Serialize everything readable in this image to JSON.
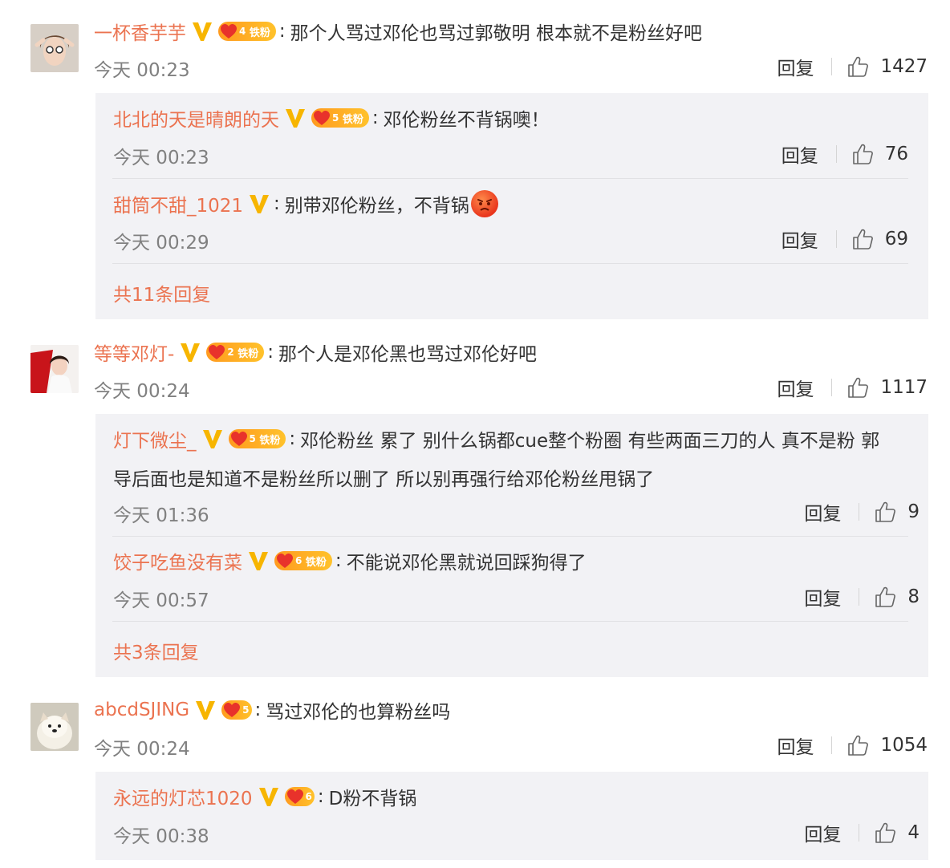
{
  "labels": {
    "reply": "回复"
  },
  "colors": {
    "username": "#eb7350",
    "reply_bg": "#f2f2f5",
    "time": "#808080",
    "badge_gold": "#ffb21f"
  },
  "comments": [
    {
      "user": "一杯香芋芋",
      "badge": "铁粉",
      "level": "4",
      "text": "那个人骂过邓伦也骂过郭敬明 根本就不是粉丝好吧",
      "time": "今天 00:23",
      "likes": "1427",
      "replies": [
        {
          "user": "北北的天是晴朗的天",
          "badge": "铁粉",
          "level": "5",
          "text": "邓伦粉丝不背锅噢！",
          "time": "今天 00:23",
          "likes": "76"
        },
        {
          "user": "甜筒不甜_1021",
          "text": "别带邓伦粉丝，不背锅",
          "emoji": "angry-face-icon",
          "time": "今天 00:29",
          "likes": "69"
        }
      ],
      "more": "共11条回复"
    },
    {
      "user": "等等邓灯-",
      "badge": "铁粉",
      "level": "2",
      "text": "那个人是邓伦黑也骂过邓伦好吧",
      "time": "今天 00:24",
      "likes": "1117",
      "replies": [
        {
          "user": "灯下微尘_",
          "badge": "铁粉",
          "level": "5",
          "text": "邓伦粉丝 累了 别什么锅都cue整个粉圈 有些两面三刀的人 真不是粉 郭",
          "text2": "导后面也是知道不是粉丝所以删了 所以别再强行给邓伦粉丝甩锅了",
          "time": "今天 01:36",
          "likes": "9"
        },
        {
          "user": "饺子吃鱼没有菜",
          "badge": "铁粉",
          "level": "6",
          "text": "不能说邓伦黑就说回踩狗得了",
          "time": "今天 00:57",
          "likes": "8"
        }
      ],
      "more": "共3条回复"
    },
    {
      "user": "abcdSJING",
      "level": "5",
      "text": "骂过邓伦的也算粉丝吗",
      "time": "今天 00:24",
      "likes": "1054",
      "replies": [
        {
          "user": "永远的灯芯1020",
          "level": "6",
          "text": "D粉不背锅",
          "time": "今天 00:38",
          "likes": "4"
        }
      ]
    }
  ]
}
